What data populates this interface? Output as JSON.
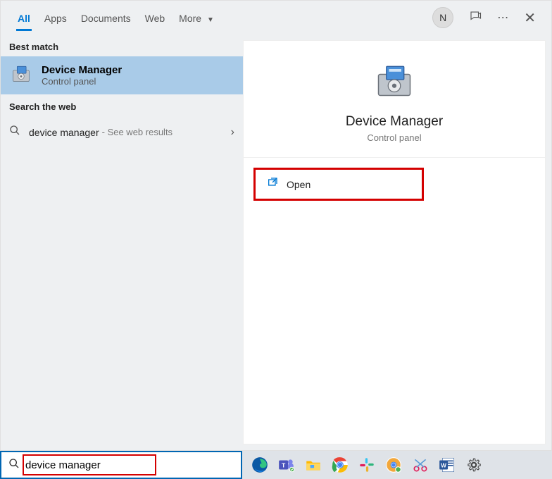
{
  "tabs": {
    "all": "All",
    "apps": "Apps",
    "documents": "Documents",
    "web": "Web",
    "more": "More"
  },
  "avatar_initial": "N",
  "sections": {
    "best_match": "Best match",
    "search_web": "Search the web"
  },
  "best_match": {
    "title": "Device Manager",
    "subtitle": "Control panel"
  },
  "web_result": {
    "label": "device manager",
    "hint": "- See web results"
  },
  "right_pane": {
    "title": "Device Manager",
    "subtitle": "Control panel",
    "open": "Open"
  },
  "search": {
    "value": "device manager"
  }
}
